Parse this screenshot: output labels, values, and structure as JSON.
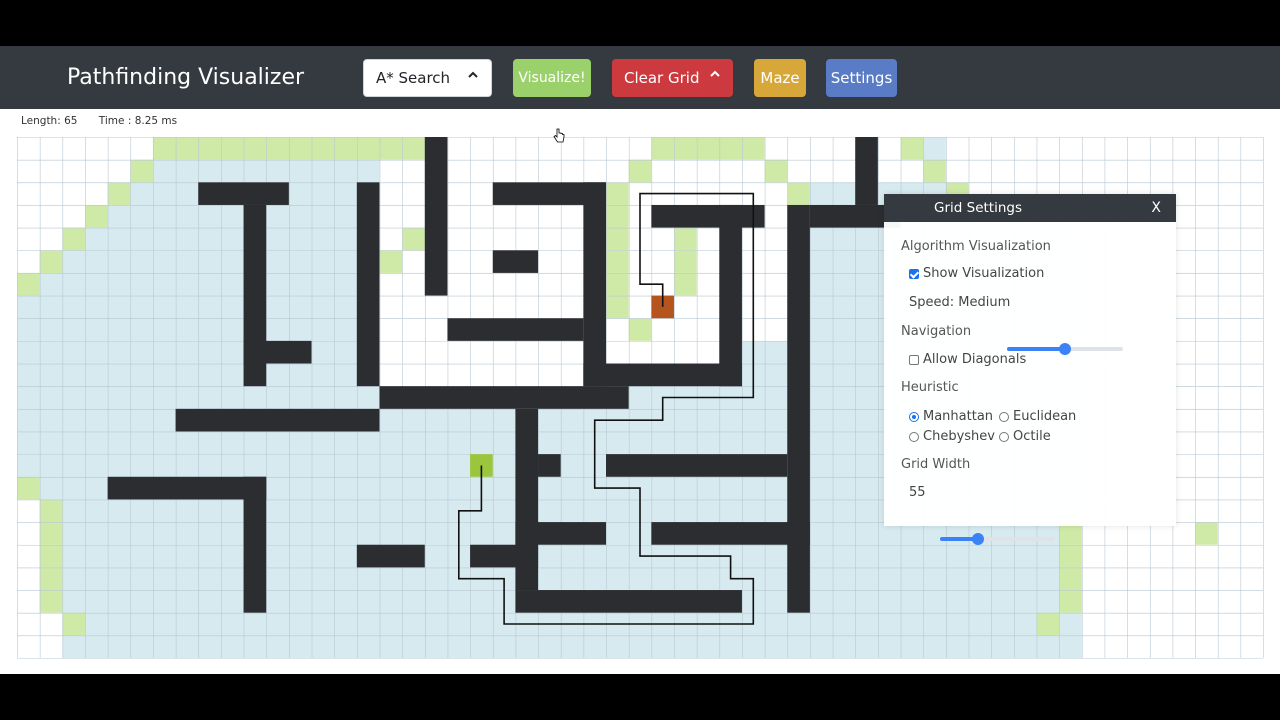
{
  "header": {
    "brand": "Pathfinding Visualizer",
    "algorithm_select": "A* Search",
    "visualize_label": "Visualize!",
    "clear_label": "Clear Grid",
    "maze_label": "Maze",
    "settings_label": "Settings"
  },
  "stats": {
    "length": "Length: 65",
    "time": "Time : 8.25 ms"
  },
  "colors": {
    "visited": "#d6eaf0",
    "frontier": "#cfeaa6",
    "wall": "#2b2d30",
    "start": "#9bc53d",
    "target": "#b5541c",
    "navbar": "#343a40",
    "gridline": "#b9c8d3"
  },
  "icons": {
    "dropdown": "chevron-up-icon",
    "cursor": "hand-pointer-icon"
  },
  "grid": {
    "cols": 55,
    "rows": 23,
    "walls": [
      [
        18,
        0,
        7,
        false
      ],
      [
        37,
        0,
        3,
        false
      ],
      [
        8,
        2,
        4,
        true
      ],
      [
        21,
        2,
        5,
        true
      ],
      [
        10,
        3,
        8,
        false
      ],
      [
        15,
        2,
        9,
        false
      ],
      [
        25,
        2,
        9,
        false
      ],
      [
        28,
        3,
        5,
        true
      ],
      [
        31,
        3,
        8,
        false
      ],
      [
        34,
        3,
        18,
        false
      ],
      [
        35,
        3,
        4,
        true
      ],
      [
        21,
        5,
        2,
        true
      ],
      [
        19,
        8,
        6,
        true
      ],
      [
        10,
        9,
        3,
        true
      ],
      [
        25,
        10,
        7,
        true
      ],
      [
        16,
        11,
        11,
        true
      ],
      [
        7,
        12,
        9,
        true
      ],
      [
        22,
        12,
        8,
        false
      ],
      [
        23,
        14,
        1,
        true
      ],
      [
        26,
        14,
        8,
        true
      ],
      [
        4,
        15,
        7,
        true
      ],
      [
        10,
        15,
        6,
        false
      ],
      [
        22,
        17,
        4,
        true
      ],
      [
        28,
        17,
        7,
        true
      ],
      [
        15,
        18,
        3,
        true
      ],
      [
        20,
        18,
        3,
        true
      ],
      [
        22,
        20,
        10,
        true
      ]
    ],
    "white_region": [
      [
        16,
        1,
        19
      ],
      [
        16,
        2,
        19
      ],
      [
        16,
        3,
        19
      ],
      [
        16,
        4,
        19
      ],
      [
        16,
        5,
        19
      ],
      [
        16,
        6,
        19
      ],
      [
        16,
        7,
        19
      ],
      [
        16,
        8,
        19
      ],
      [
        16,
        9,
        9
      ],
      [
        16,
        10,
        9
      ],
      [
        26,
        8,
        5
      ],
      [
        26,
        9,
        5
      ],
      [
        27,
        10,
        4
      ]
    ],
    "frontier": [
      [
        6,
        0,
        12
      ],
      [
        5,
        1,
        1
      ],
      [
        4,
        2,
        1
      ],
      [
        3,
        3,
        1
      ],
      [
        2,
        4,
        1
      ],
      [
        1,
        5,
        1
      ],
      [
        0,
        6,
        1
      ],
      [
        28,
        0,
        5
      ],
      [
        27,
        1,
        1
      ],
      [
        33,
        1,
        1
      ],
      [
        34,
        2,
        1
      ],
      [
        26,
        2,
        1
      ],
      [
        26,
        3,
        1
      ],
      [
        26,
        4,
        1
      ],
      [
        26,
        5,
        1
      ],
      [
        26,
        6,
        1
      ],
      [
        26,
        7,
        1
      ],
      [
        29,
        4,
        1
      ],
      [
        29,
        5,
        1
      ],
      [
        29,
        6,
        1
      ],
      [
        27,
        8,
        1
      ],
      [
        17,
        4,
        1
      ],
      [
        16,
        5,
        1
      ],
      [
        39,
        0,
        1
      ],
      [
        40,
        1,
        1
      ],
      [
        41,
        2,
        1
      ],
      [
        0,
        15,
        1
      ],
      [
        1,
        16,
        1
      ],
      [
        1,
        17,
        1
      ],
      [
        1,
        18,
        1
      ],
      [
        1,
        19,
        1
      ],
      [
        1,
        20,
        1
      ],
      [
        2,
        21,
        1
      ],
      [
        46,
        17,
        1
      ],
      [
        46,
        18,
        1
      ],
      [
        46,
        19,
        1
      ],
      [
        46,
        20,
        1
      ],
      [
        45,
        21,
        1
      ],
      [
        52,
        17,
        1
      ]
    ],
    "start": [
      20,
      14
    ],
    "target": [
      28,
      7
    ],
    "path": [
      [
        28,
        7
      ],
      [
        28,
        6
      ],
      [
        27,
        6
      ],
      [
        27,
        2
      ],
      [
        32,
        2
      ],
      [
        32,
        11
      ],
      [
        28,
        11
      ],
      [
        28,
        12
      ],
      [
        25,
        12
      ],
      [
        25,
        15
      ],
      [
        27,
        15
      ],
      [
        27,
        18
      ],
      [
        31,
        18
      ],
      [
        31,
        19
      ],
      [
        32,
        19
      ],
      [
        32,
        21
      ],
      [
        21,
        21
      ],
      [
        21,
        19
      ],
      [
        19,
        19
      ],
      [
        19,
        16
      ],
      [
        20,
        16
      ],
      [
        20,
        14
      ]
    ]
  },
  "settings_panel": {
    "title": "Grid Settings",
    "close": "X",
    "algorithm_section": "Algorithm Visualization",
    "show_visualization": "Show Visualization",
    "show_visualization_checked": true,
    "speed_label": "Speed: Medium",
    "speed_level": 0.5,
    "navigation_section": "Navigation",
    "allow_diagonals": "Allow Diagonals",
    "allow_diagonals_checked": false,
    "heuristic_section": "Heuristic",
    "heuristics": [
      "Manhattan",
      "Euclidean",
      "Chebyshev",
      "Octile"
    ],
    "heuristic_selected": "Manhattan",
    "grid_width_section": "Grid Width",
    "grid_width_value": "55",
    "grid_width_level": 0.33
  }
}
